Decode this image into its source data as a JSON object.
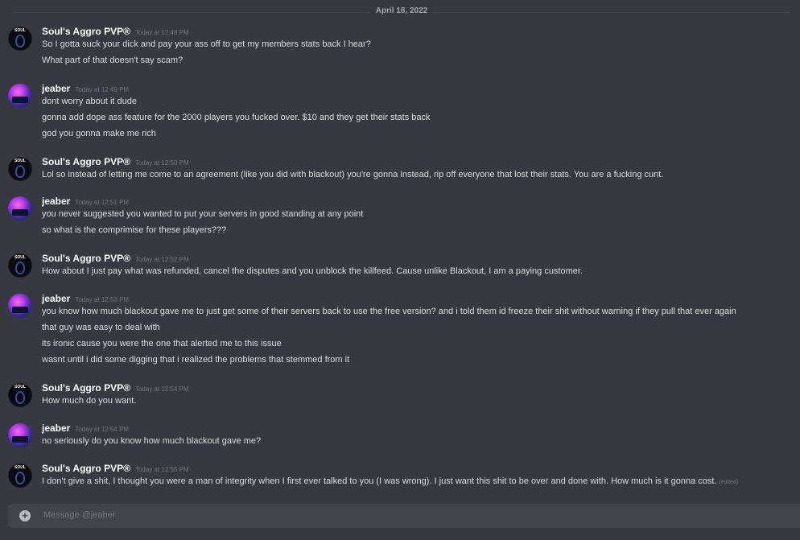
{
  "date_divider": "April 18, 2022",
  "messages": [
    {
      "author": "Soul's Aggro PVP®",
      "time": "Today at 12:48 PM",
      "lines": [
        "So I gotta suck your dick and pay your ass off to get my members stats back I hear?",
        "What part of that doesn't say scam?"
      ]
    },
    {
      "author": "jeaber",
      "time": "Today at 12:49 PM",
      "lines": [
        "dont worry about it dude",
        "gonna add dope ass feature for the 2000 players you fucked over. $10 and they get their stats back",
        "god you gonna make me rich"
      ]
    },
    {
      "author": "Soul's Aggro PVP®",
      "time": "Today at 12:50 PM",
      "lines": [
        "Lol so instead of letting me come to an agreement (like you did with blackout) you're gonna instead, rip off everyone that lost their stats. You are a fucking cunt."
      ]
    },
    {
      "author": "jeaber",
      "time": "Today at 12:51 PM",
      "lines": [
        "you never suggested you wanted to put your servers in good standing at any point",
        "so what is the comprimise for these players???"
      ]
    },
    {
      "author": "Soul's Aggro PVP®",
      "time": "Today at 12:52 PM",
      "lines": [
        "How about I just pay what was refunded, cancel the disputes and you unblock the killfeed. Cause unlike Blackout, I am a paying customer."
      ]
    },
    {
      "author": "jeaber",
      "time": "Today at 12:53 PM",
      "lines": [
        "you know how much blackout gave me to just get some of their servers back to use the free version? and i told them id freeze their shit without warning if they pull that ever again",
        "that guy was easy to deal with",
        "its ironic cause you were the one that alerted me to this issue",
        "wasnt until i did some digging that i realized the problems that stemmed from it"
      ]
    },
    {
      "author": "Soul's Aggro PVP®",
      "time": "Today at 12:54 PM",
      "lines": [
        "How much do you want."
      ]
    },
    {
      "author": "jeaber",
      "time": "Today at 12:54 PM",
      "lines": [
        "no seriously do you know how much blackout gave me?"
      ]
    },
    {
      "author": "Soul's Aggro PVP®",
      "time": "Today at 12:55 PM",
      "lines": [
        "I don't give a shit, I thought you were a man of integrity when I first ever talked to you (I was wrong). I just want this shit to be over and done with. How much is it gonna cost."
      ],
      "edited": "(edited)"
    }
  ],
  "avatar_label": "SOUL",
  "input": {
    "placeholder": "Message @jeaber"
  },
  "icons": {
    "attach": "plus-circle-icon"
  }
}
